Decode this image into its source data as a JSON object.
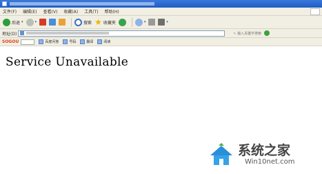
{
  "menu": {
    "items": [
      "文件(F)",
      "编辑(E)",
      "查看(V)",
      "收藏(A)",
      "工具(T)",
      "帮助(H)"
    ]
  },
  "toolbar": {
    "back_label": "后退",
    "search_label": "搜索",
    "favorites_label": "收藏夹"
  },
  "address": {
    "label": "地址(D)",
    "hint": "↖ 输入关键字搜索"
  },
  "links": {
    "brand": "SOGOU",
    "items": [
      "百度问答",
      "号码",
      "翻译",
      "阅读"
    ]
  },
  "page": {
    "message": "Service Unavailable"
  },
  "watermark": {
    "brand_cn": "系统之家",
    "url": "Win10net.com"
  }
}
